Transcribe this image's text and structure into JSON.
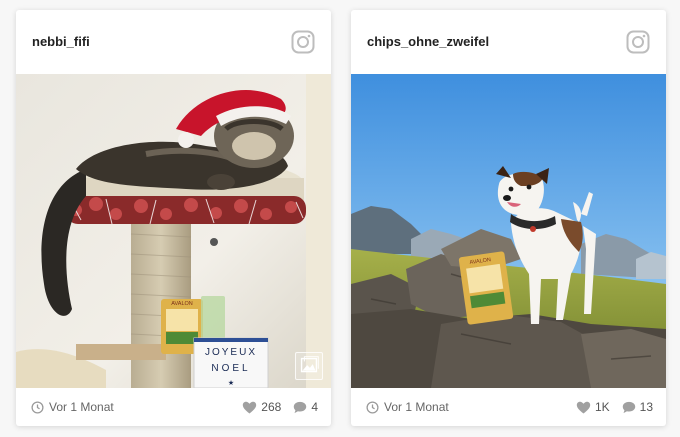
{
  "posts": [
    {
      "username": "nebbi_fifi",
      "time": "Vor 1 Monat",
      "likes": "268",
      "comments": "4",
      "sign_line1": "JOYEUX",
      "sign_line2": "NOEL",
      "package_label": "AVALON"
    },
    {
      "username": "chips_ohne_zweifel",
      "time": "Vor 1 Monat",
      "likes": "1K",
      "comments": "13",
      "package_label": "AVALON"
    }
  ],
  "icons": {
    "header": "instagram-icon",
    "time": "clock-icon",
    "likes": "heart-icon",
    "comments": "comment-icon",
    "gallery": "image-gallery-icon"
  },
  "colors": {
    "icon_gray": "#bdbdbd",
    "text_dark": "#222222",
    "text_muted": "#666666"
  }
}
